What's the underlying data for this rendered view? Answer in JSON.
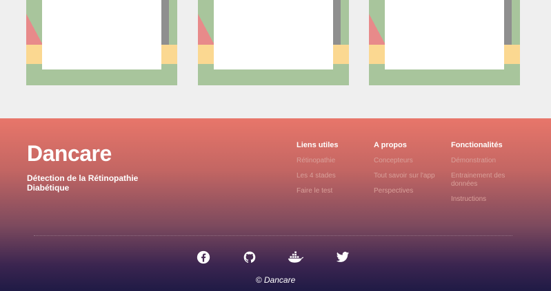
{
  "footer": {
    "brand": "Dancare",
    "tagline": "Détection de la Rétinopathie Diabétique",
    "columns": [
      {
        "title": "Liens utiles",
        "links": [
          "Rétinopathie",
          "Les 4 stades",
          "Faire le test"
        ]
      },
      {
        "title": "A propos",
        "links": [
          "Concepteurs",
          "Tout savoir sur l'app",
          "Perspectives"
        ]
      },
      {
        "title": "Fonctionalités",
        "links": [
          "Démonstration",
          "Entrainement des données",
          "Instructions"
        ]
      }
    ],
    "social_icons": [
      "facebook-icon",
      "github-icon",
      "docker-icon",
      "twitter-icon"
    ],
    "copyright": "© Dancare"
  },
  "colors": {
    "card_green": "#a8c59c",
    "card_pink": "#e88a8a",
    "card_yellow": "#fbd891",
    "card_gray": "#8f8f8f",
    "footer_top": "#e8766a",
    "footer_bottom": "#1f1a45"
  }
}
